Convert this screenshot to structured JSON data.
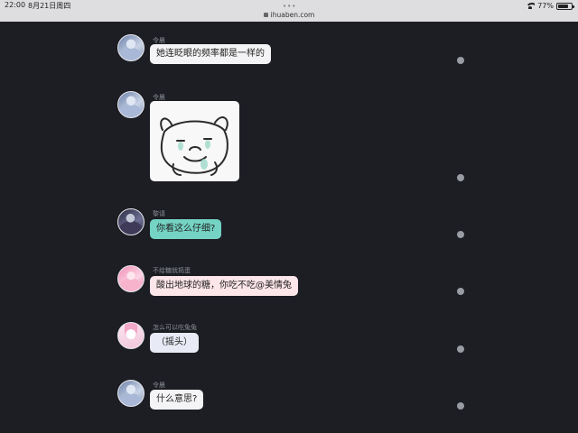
{
  "statusbar": {
    "time": "22:00",
    "date": "8月21日周四",
    "url": "ihuaben.com",
    "battery_text": "77%",
    "battery_level": 0.77,
    "tab_dots": "•••"
  },
  "messages": [
    {
      "sender": "令晨",
      "avatar": "lingjin-avatar",
      "text": "她连眨眼的频率都是一样的"
    },
    {
      "sender": "令晨",
      "avatar": "lingjin-avatar",
      "sticker": "bear-sticker"
    },
    {
      "sender": "黎请",
      "avatar": "liqing-avatar",
      "text": "你看这么仔细?",
      "bubble_color": "#74d3c4"
    },
    {
      "sender": "不给糖就捣蛋",
      "avatar": "pink-girl-avatar",
      "text": "酸出地球的糖，你吃不吃@美情兔",
      "bubble_color": "#fde6ea"
    },
    {
      "sender": "怎么可以吃兔兔",
      "avatar": "rabbit-avatar",
      "text": "（摇头）",
      "bubble_color": "#e8eaf5"
    },
    {
      "sender": "令晨",
      "avatar": "lingjin-avatar",
      "text": "什么意思?"
    }
  ]
}
